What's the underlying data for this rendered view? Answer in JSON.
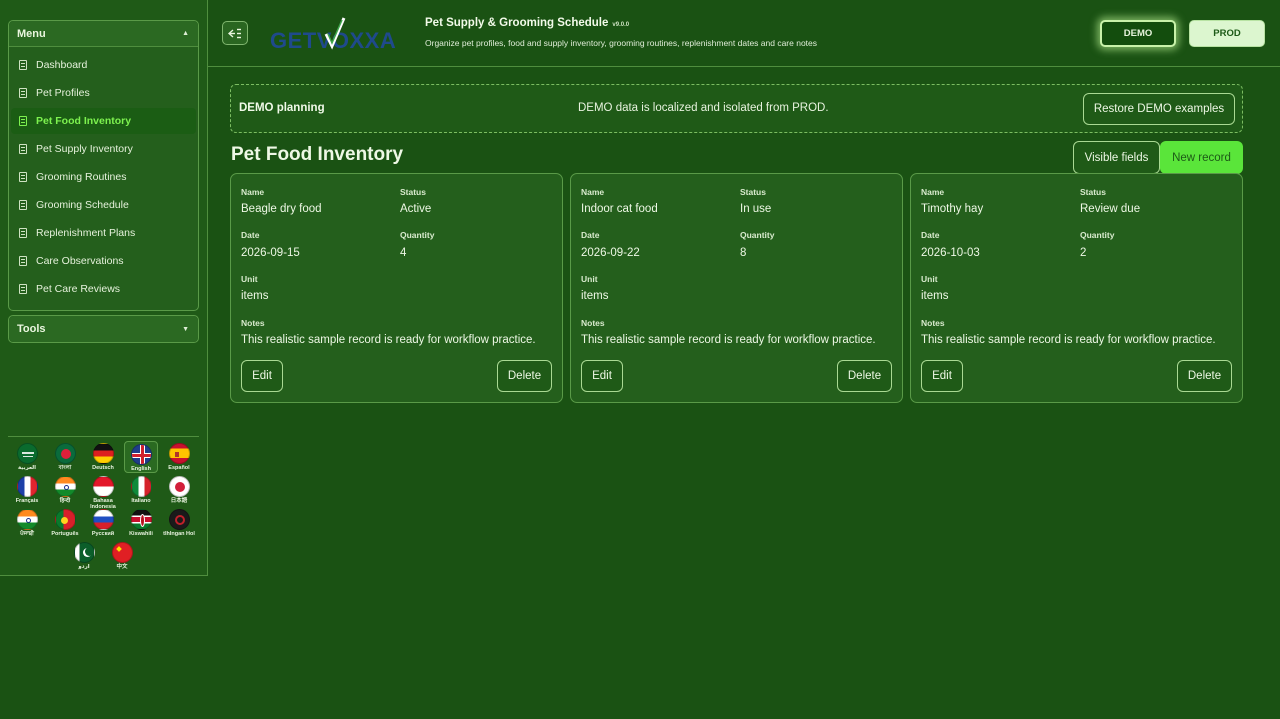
{
  "sidebar": {
    "menu_title": "Menu",
    "tools_title": "Tools",
    "items": [
      {
        "label": "Dashboard"
      },
      {
        "label": "Pet Profiles"
      },
      {
        "label": "Pet Food Inventory",
        "active": true
      },
      {
        "label": "Pet Supply Inventory"
      },
      {
        "label": "Grooming Routines"
      },
      {
        "label": "Grooming Schedule"
      },
      {
        "label": "Replenishment Plans"
      },
      {
        "label": "Care Observations"
      },
      {
        "label": "Pet Care Reviews"
      }
    ],
    "languages": [
      {
        "label": "العربية",
        "icon": "saudi-flag-icon"
      },
      {
        "label": "বাংলা",
        "icon": "bangladesh-flag-icon"
      },
      {
        "label": "Deutsch",
        "icon": "germany-flag-icon"
      },
      {
        "label": "English",
        "icon": "uk-flag-icon",
        "selected": true
      },
      {
        "label": "Español",
        "icon": "spain-flag-icon"
      },
      {
        "label": "Français",
        "icon": "france-flag-icon"
      },
      {
        "label": "हिन्दी",
        "icon": "india-flag-icon"
      },
      {
        "label": "Bahasa Indonesia",
        "icon": "indonesia-flag-icon"
      },
      {
        "label": "Italiano",
        "icon": "italy-flag-icon"
      },
      {
        "label": "日本語",
        "icon": "japan-flag-icon"
      },
      {
        "label": "ਪੰਜਾਬੀ",
        "icon": "india-flag-icon"
      },
      {
        "label": "Português",
        "icon": "portugal-flag-icon"
      },
      {
        "label": "Русский",
        "icon": "russia-flag-icon"
      },
      {
        "label": "Kiswahili",
        "icon": "kenya-flag-icon"
      },
      {
        "label": "tlhIngan Hol",
        "icon": "klingon-flag-icon"
      },
      {
        "label": "اردو",
        "icon": "pakistan-flag-icon"
      },
      {
        "label": "中文",
        "icon": "china-flag-icon"
      }
    ]
  },
  "header": {
    "logo_text": "GETVOXXA",
    "title": "Pet Supply & Grooming Schedule",
    "version": "v9.0.0",
    "subtitle": "Organize pet profiles, food and supply inventory, grooming routines, replenishment dates and care notes",
    "demo_label": "DEMO",
    "prod_label": "PROD"
  },
  "banner": {
    "title": "DEMO planning",
    "message": "DEMO data is localized and isolated from PROD.",
    "restore_label": "Restore DEMO examples"
  },
  "section": {
    "title": "Pet Food Inventory",
    "visible_fields_label": "Visible fields",
    "new_record_label": "New record"
  },
  "labels": {
    "name": "Name",
    "status": "Status",
    "date": "Date",
    "quantity": "Quantity",
    "unit": "Unit",
    "notes": "Notes",
    "edit": "Edit",
    "delete": "Delete"
  },
  "records": [
    {
      "name": "Beagle dry food",
      "status": "Active",
      "date": "2026-09-15",
      "quantity": "4",
      "unit": "items",
      "notes": "This realistic sample record is ready for workflow practice."
    },
    {
      "name": "Indoor cat food",
      "status": "In use",
      "date": "2026-09-22",
      "quantity": "8",
      "unit": "items",
      "notes": "This realistic sample record is ready for workflow practice."
    },
    {
      "name": "Timothy hay",
      "status": "Review due",
      "date": "2026-10-03",
      "quantity": "2",
      "unit": "items",
      "notes": "This realistic sample record is ready for workflow practice."
    }
  ],
  "colors": {
    "background": "#1a5213",
    "accent": "#5ae53a",
    "active_text": "#7df24f"
  }
}
